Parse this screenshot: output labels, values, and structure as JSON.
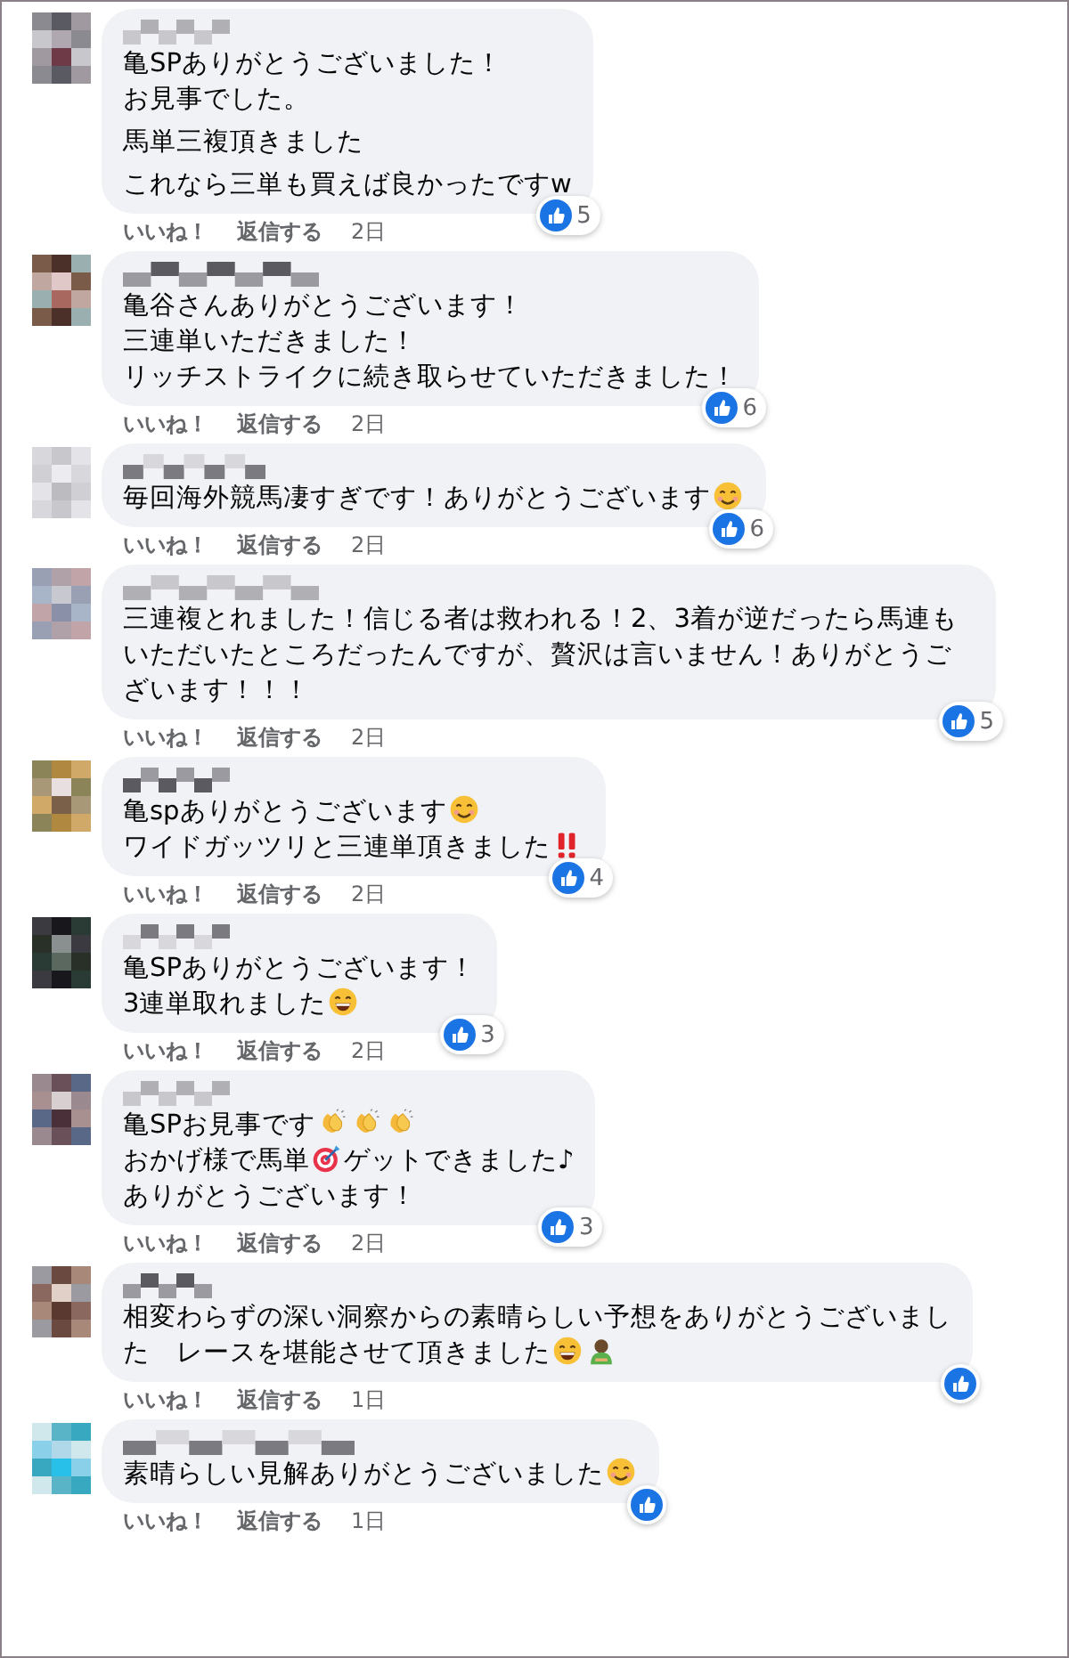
{
  "comments": [
    {
      "paragraphs": [
        [
          [
            {
              "kind": "text",
              "text": "亀SPありがとうございました！"
            }
          ],
          [
            {
              "kind": "text",
              "text": "お見事でした。"
            }
          ]
        ],
        [
          [
            {
              "kind": "text",
              "text": "馬単三複頂きました"
            }
          ]
        ],
        [
          [
            {
              "kind": "text",
              "text": "これなら三単も買えば良かったですw"
            }
          ]
        ]
      ],
      "like_label": "いいね！",
      "reply_label": "返信する",
      "time": "2日",
      "reaction_count": "5"
    },
    {
      "paragraphs": [
        [
          [
            {
              "kind": "text",
              "text": "亀谷さんありがとうございます！"
            }
          ],
          [
            {
              "kind": "text",
              "text": "三連単いただきました！"
            }
          ],
          [
            {
              "kind": "text",
              "text": "リッチストライクに続き取らせていただきました！"
            }
          ]
        ]
      ],
      "like_label": "いいね！",
      "reply_label": "返信する",
      "time": "2日",
      "reaction_count": "6"
    },
    {
      "paragraphs": [
        [
          [
            {
              "kind": "text",
              "text": "毎回海外競馬凄すぎです！ありがとうございます"
            },
            {
              "kind": "smile"
            }
          ]
        ]
      ],
      "like_label": "いいね！",
      "reply_label": "返信する",
      "time": "2日",
      "reaction_count": "6"
    },
    {
      "paragraphs": [
        [
          [
            {
              "kind": "text",
              "text": "三連複とれました！信じる者は救われる！2、3着が逆だったら馬連もいただいたところだったんですが、贅沢は言いません！ありがとうございます！！！"
            }
          ]
        ]
      ],
      "like_label": "いいね！",
      "reply_label": "返信する",
      "time": "2日",
      "reaction_count": "5"
    },
    {
      "paragraphs": [
        [
          [
            {
              "kind": "text",
              "text": "亀spありがとうございます"
            },
            {
              "kind": "smile"
            }
          ],
          [
            {
              "kind": "text",
              "text": "ワイドガッツリと三連単頂きました"
            },
            {
              "kind": "bangbang"
            }
          ]
        ]
      ],
      "like_label": "いいね！",
      "reply_label": "返信する",
      "time": "2日",
      "reaction_count": "4"
    },
    {
      "paragraphs": [
        [
          [
            {
              "kind": "text",
              "text": "亀SPありがとうございます！"
            }
          ],
          [
            {
              "kind": "text",
              "text": "3連単取れました"
            },
            {
              "kind": "grin"
            }
          ]
        ]
      ],
      "like_label": "いいね！",
      "reply_label": "返信する",
      "time": "2日",
      "reaction_count": "3"
    },
    {
      "paragraphs": [
        [
          [
            {
              "kind": "text",
              "text": "亀SPお見事です"
            },
            {
              "kind": "clap"
            },
            {
              "kind": "clap"
            },
            {
              "kind": "clap"
            }
          ],
          [
            {
              "kind": "text",
              "text": "おかげ様で馬単"
            },
            {
              "kind": "target"
            },
            {
              "kind": "text",
              "text": "ゲットできました♪"
            }
          ],
          [
            {
              "kind": "text",
              "text": "ありがとうございます！"
            }
          ]
        ]
      ],
      "like_label": "いいね！",
      "reply_label": "返信する",
      "time": "2日",
      "reaction_count": "3"
    },
    {
      "paragraphs": [
        [
          [
            {
              "kind": "text",
              "text": "相変わらずの深い洞察からの素晴らしい予想をありがとうございまし"
            }
          ],
          [
            {
              "kind": "text",
              "text": "た　レースを堪能させて頂きました"
            },
            {
              "kind": "grin"
            },
            {
              "kind": "bow"
            }
          ]
        ]
      ],
      "like_label": "いいね！",
      "reply_label": "返信する",
      "time": "1日"
    },
    {
      "paragraphs": [
        [
          [
            {
              "kind": "text",
              "text": "素晴らしい見解ありがとうございました"
            },
            {
              "kind": "smile"
            }
          ]
        ]
      ],
      "like_label": "いいね！",
      "reply_label": "返信する",
      "time": "1日"
    }
  ]
}
